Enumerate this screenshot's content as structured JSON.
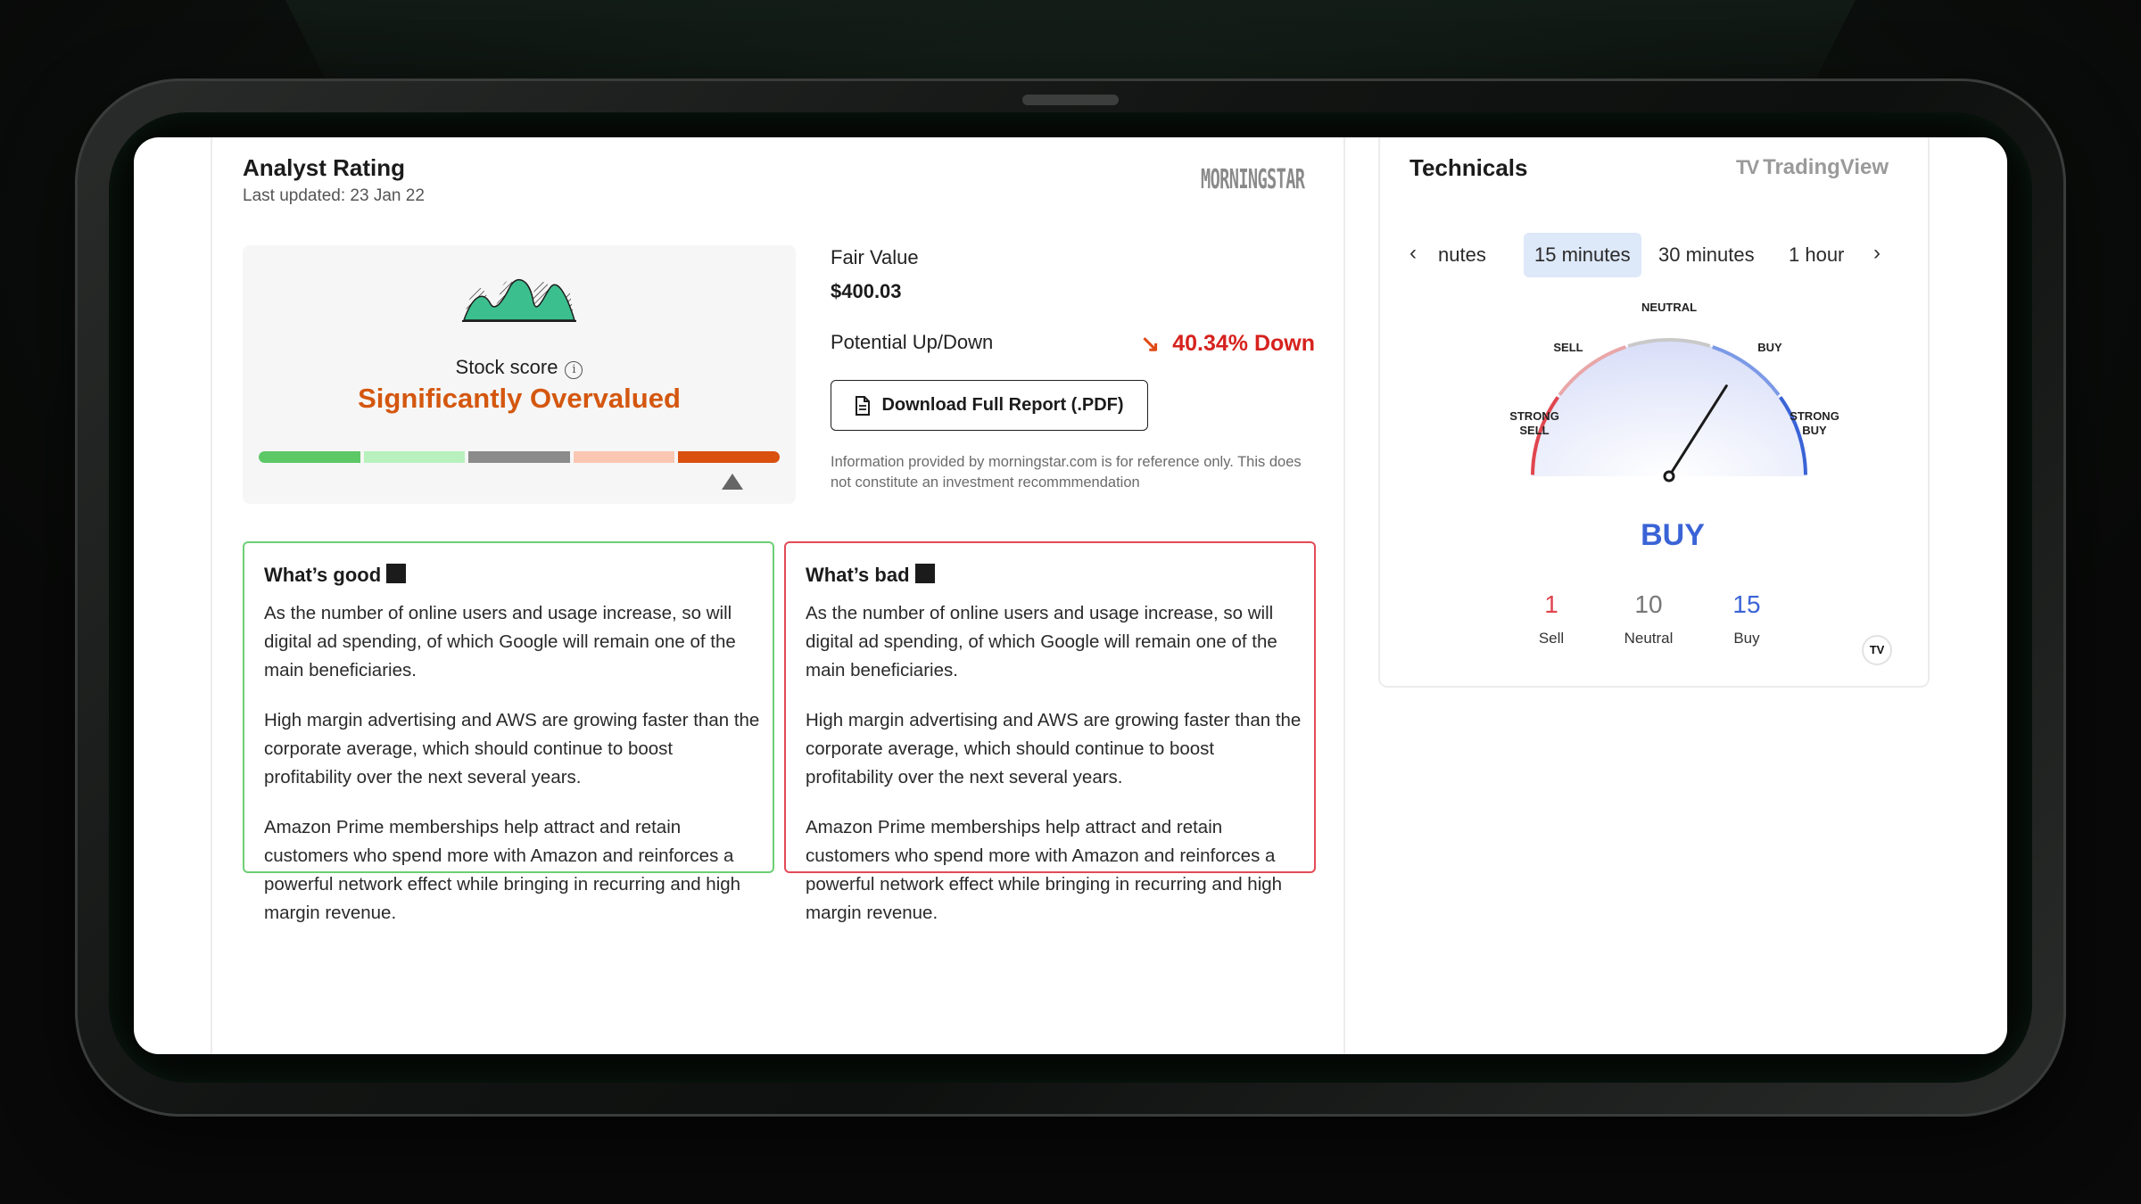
{
  "analyst": {
    "title": "Analyst Rating",
    "last_updated": "Last updated: 23 Jan 22",
    "provider_logo": "MORNINGSTAR",
    "stock_score_label": "Stock score",
    "stock_score_value": "Significantly Overvalued",
    "scale_colors": [
      "#5cc866",
      "#b8f1be",
      "#8b8b8b",
      "#fbc7b2",
      "#d9500f"
    ],
    "scale_selected_index": 4,
    "fair_value_label": "Fair Value",
    "fair_value": "$400.03",
    "potential_label": "Potential Up/Down",
    "potential_value": "40.34% Down",
    "download_label": "Download Full Report (.PDF)",
    "disclaimer": "Information provided by morningstar.com is for reference only. This does not constitute an investment recommmendation",
    "good": {
      "title": "What’s good",
      "points": [
        "As the number of online users and usage increase, so will digital ad spending, of which Google will remain one of the main beneficiaries.",
        "High margin advertising and AWS are growing faster than the corporate average, which should continue to boost profitability over the next several years.",
        "Amazon Prime memberships help attract and retain customers who spend more with Amazon and reinforces a powerful network effect while bringing in recurring and high margin revenue."
      ]
    },
    "bad": {
      "title": "What’s bad",
      "points": [
        "As the number of online users and usage increase, so will digital ad spending, of which Google will remain one of the main beneficiaries.",
        "High margin advertising and AWS are growing faster than the corporate average, which should continue to boost profitability over the next several years.",
        "Amazon Prime memberships help attract and retain customers who spend more with Amazon and reinforces a powerful network effect while bringing in recurring and high margin revenue."
      ]
    }
  },
  "technicals": {
    "title": "Technicals",
    "provider_logo": "TradingView",
    "tabs": [
      "nutes",
      "15 minutes",
      "30 minutes",
      "1 hour"
    ],
    "active_tab": 1,
    "gauge_labels": {
      "strong_sell": "STRONG SELL",
      "sell": "SELL",
      "neutral": "NEUTRAL",
      "buy": "BUY",
      "strong_buy": "STRONG BUY"
    },
    "verdict": "BUY",
    "needle_level": 0.68,
    "counts": [
      {
        "value": "1",
        "label": "Sell",
        "color": "#e0464f"
      },
      {
        "value": "10",
        "label": "Neutral",
        "color": "#777777"
      },
      {
        "value": "15",
        "label": "Buy",
        "color": "#3a63d6"
      }
    ],
    "colors": {
      "sell": "#e0464f",
      "neutral": "#c9c9c9",
      "buy": "#3a63d6"
    }
  }
}
